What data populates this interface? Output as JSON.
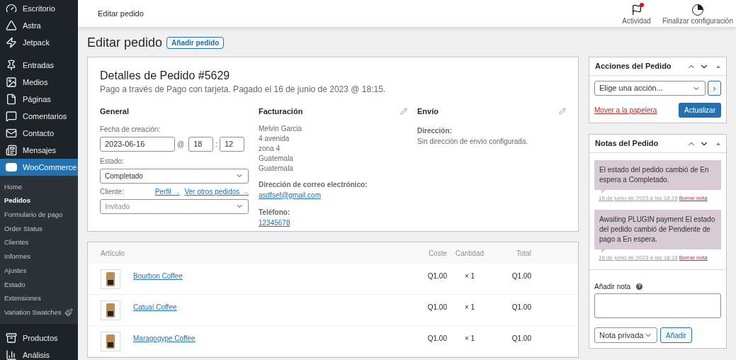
{
  "sidebar": {
    "items": [
      {
        "label": "Escritorio",
        "selected": false
      },
      {
        "label": "Astra",
        "selected": false
      },
      {
        "label": "Jetpack",
        "selected": false
      },
      {
        "label": "Entradas",
        "selected": false
      },
      {
        "label": "Medios",
        "selected": false
      },
      {
        "label": "Páginas",
        "selected": false
      },
      {
        "label": "Comentarios",
        "selected": false
      },
      {
        "label": "Contacto",
        "selected": false
      },
      {
        "label": "Mensajes",
        "selected": false
      },
      {
        "label": "WooCommerce",
        "selected": true,
        "children": [
          {
            "label": "Home",
            "selected": false
          },
          {
            "label": "Pedidos",
            "selected": true
          },
          {
            "label": "Formulario de pago",
            "selected": false
          },
          {
            "label": "Order Status",
            "selected": false
          },
          {
            "label": "Clientes",
            "selected": false
          },
          {
            "label": "Informes",
            "selected": false
          },
          {
            "label": "Ajustes",
            "selected": false
          },
          {
            "label": "Estado",
            "selected": false
          },
          {
            "label": "Extensiones",
            "selected": false
          },
          {
            "label": "Variation Swatches",
            "selected": false
          }
        ]
      },
      {
        "label": "Productos",
        "selected": false
      },
      {
        "label": "Análisis",
        "selected": false
      }
    ]
  },
  "top_bar": {
    "title": "Editar pedido",
    "actions": [
      {
        "label": "Actividad",
        "badge": true
      },
      {
        "label": "Finalizar configuración",
        "badge": false
      }
    ]
  },
  "page": {
    "title": "Editar pedido",
    "add_button": "Añadir pedido"
  },
  "order": {
    "title": "Detalles de Pedido #5629",
    "subtitle": "Pago a través de Pago con tarjeta. Pagado el 16 de junio de 2023 @ 18:15.",
    "general": {
      "heading": "General",
      "date_label": "Fecha de creación:",
      "date": "2023-06-16",
      "at": "@",
      "hour": "18",
      "colon": ":",
      "minute": "12",
      "status_label": "Estado:",
      "status": "Completado",
      "customer_label": "Cliente:",
      "profile_link": "Perfil →",
      "other_orders_link": "Ver otros pedidos →",
      "customer": "Invitado"
    },
    "billing": {
      "heading": "Facturación",
      "address": [
        "Melvin Garcia",
        "4 avenida",
        "zona 4",
        "Guatemala",
        "Guatemala"
      ],
      "email_label": "Dirección de correo electrónico:",
      "email": "asdfsef@gmail.com",
      "phone_label": "Teléfono:",
      "phone": "12345678"
    },
    "shipping": {
      "heading": "Envío",
      "address_label": "Dirección:",
      "address": "Sin dirección de envío configurada."
    }
  },
  "items": {
    "columns": [
      "Artículo",
      "Coste",
      "Cantidad",
      "Total"
    ],
    "rows": [
      {
        "name": "Bourbon Coffee",
        "cost": "Q1.00",
        "qty": "× 1",
        "total": "Q1.00"
      },
      {
        "name": "Catuaí Coffee",
        "cost": "Q1.00",
        "qty": "× 1",
        "total": "Q1.00"
      },
      {
        "name": "Maragogype Coffee",
        "cost": "Q1.00",
        "qty": "× 1",
        "total": "Q1.00"
      }
    ]
  },
  "actions_box": {
    "title": "Acciones del Pedido",
    "select": "Elige una acción...",
    "go": "›",
    "trash": "Mover a la papelera",
    "update": "Actualizar"
  },
  "notes_box": {
    "title": "Notas del Pedido",
    "notes": [
      {
        "text": "El estado del pedido cambió de En espera a Completado.",
        "meta": "16 de junio de 2023 a las 18:15",
        "delete": "Borrar nota"
      },
      {
        "text": "Awaiting PLUGIN payment El estado del pedido cambió de Pendiente de pago a En espera.",
        "meta": "16 de junio de 2023 a las 18:15",
        "delete": "Borrar nota"
      }
    ],
    "add_label": "Añadir nota",
    "help": "?",
    "type": "Nota privada",
    "add_button": "Añadir"
  }
}
